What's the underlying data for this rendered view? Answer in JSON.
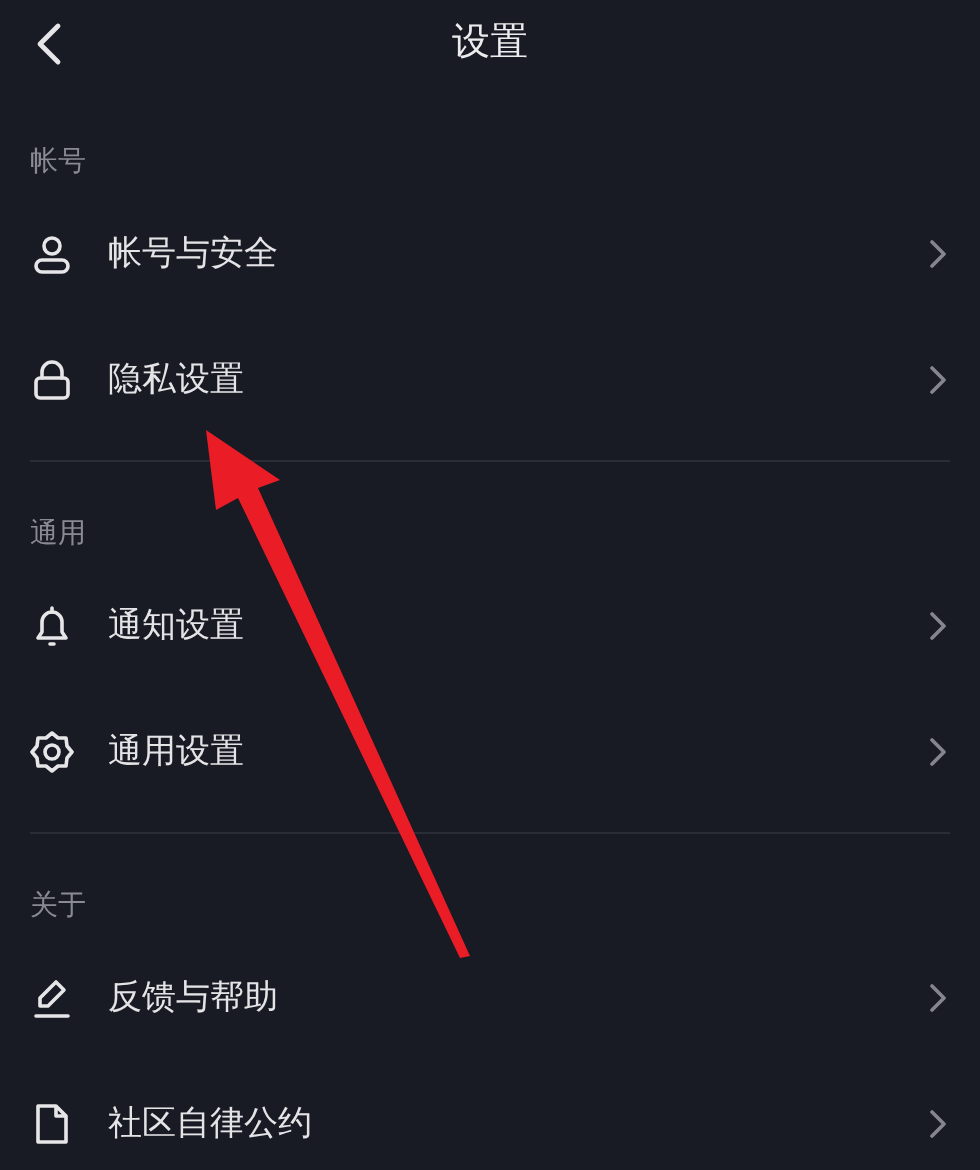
{
  "header": {
    "title": "设置"
  },
  "sections": [
    {
      "label": "帐号",
      "items": [
        {
          "label": "帐号与安全"
        },
        {
          "label": "隐私设置"
        }
      ]
    },
    {
      "label": "通用",
      "items": [
        {
          "label": "通知设置"
        },
        {
          "label": "通用设置"
        }
      ]
    },
    {
      "label": "关于",
      "items": [
        {
          "label": "反馈与帮助"
        },
        {
          "label": "社区自律公约"
        }
      ]
    }
  ]
}
